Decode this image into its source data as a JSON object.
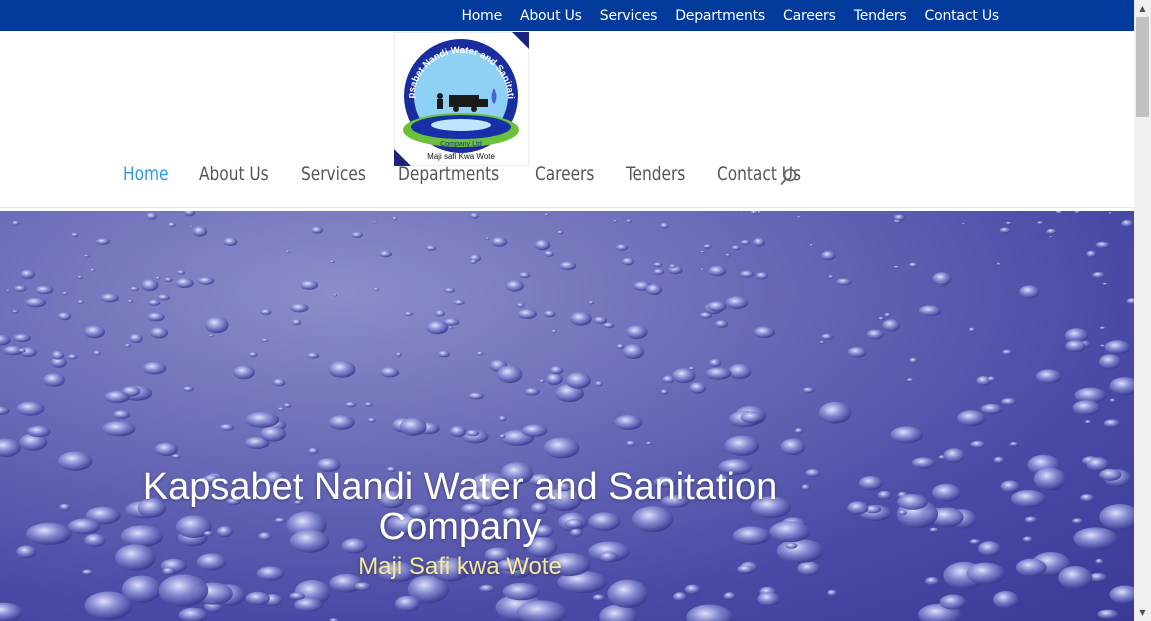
{
  "top_nav": [
    {
      "label": "Home"
    },
    {
      "label": "About Us"
    },
    {
      "label": "Services"
    },
    {
      "label": "Departments"
    },
    {
      "label": "Careers"
    },
    {
      "label": "Tenders"
    },
    {
      "label": "Contact Us"
    }
  ],
  "logo": {
    "ring_text": "Kapsabet Nandi Water and Sanitation",
    "company_text": "Company Ltd",
    "tagline": "Maji safi Kwa Wote"
  },
  "main_nav": [
    {
      "label": "Home",
      "active": true
    },
    {
      "label": "About Us"
    },
    {
      "label": "Services"
    },
    {
      "label": "Departments"
    },
    {
      "label": "Careers"
    },
    {
      "label": "Tenders"
    },
    {
      "label": "Contact Us"
    }
  ],
  "search": {
    "icon": "search-icon"
  },
  "hero": {
    "title_line1": "Kapsabet Nandi Water and Sanitation",
    "title_line2": "Company",
    "subtitle": "Maji Safi kwa Wote"
  },
  "colors": {
    "top_bar": "#023b9b",
    "nav_active": "#2f9bdc",
    "nav_text": "#555555",
    "hero_subtitle": "#f4ea9a"
  }
}
